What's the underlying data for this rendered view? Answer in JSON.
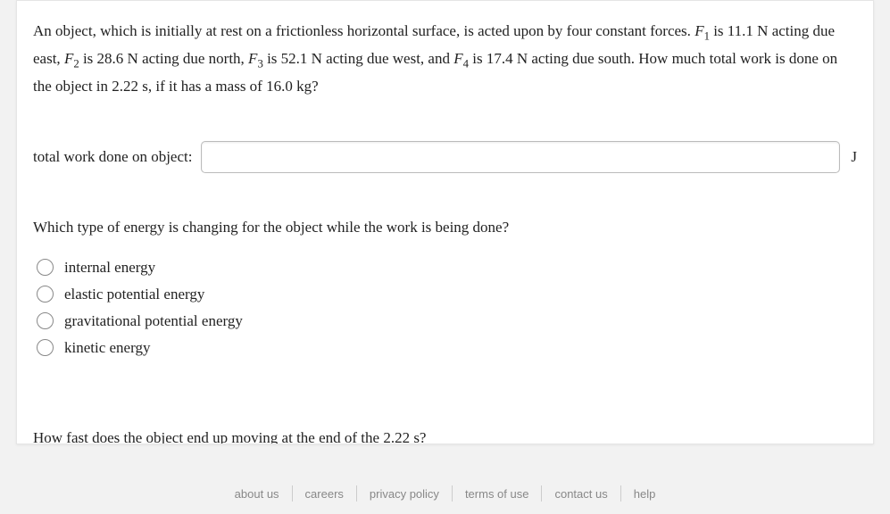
{
  "problem": {
    "intro_a": "An object, which is initially at rest on a frictionless horizontal surface, is acted upon by four constant forces. ",
    "f1_var": "F",
    "f1_sub": "1",
    "f1_text": " is 11.1 N acting due east, ",
    "f2_var": "F",
    "f2_sub": "2",
    "f2_text": " is 28.6 N acting due north, ",
    "f3_var": "F",
    "f3_sub": "3",
    "f3_text": " is 52.1 N acting due west, and ",
    "f4_var": "F",
    "f4_sub": "4",
    "f4_text": " is 17.4 N acting due south. How much total work is done on the object in 2.22 s, if it has a mass of 16.0 kg?"
  },
  "answer": {
    "label": "total work done on object:",
    "value": "",
    "unit": "J"
  },
  "sub_question": "Which type of energy is changing for the object while the work is being done?",
  "options": [
    {
      "label": "internal energy"
    },
    {
      "label": "elastic potential energy"
    },
    {
      "label": "gravitational potential energy"
    },
    {
      "label": "kinetic energy"
    }
  ],
  "cutoff": "How fast does the object end up moving at the end of the 2.22 s?",
  "footer": {
    "about": "about us",
    "careers": "careers",
    "privacy": "privacy policy",
    "terms": "terms of use",
    "contact": "contact us",
    "help": "help"
  }
}
